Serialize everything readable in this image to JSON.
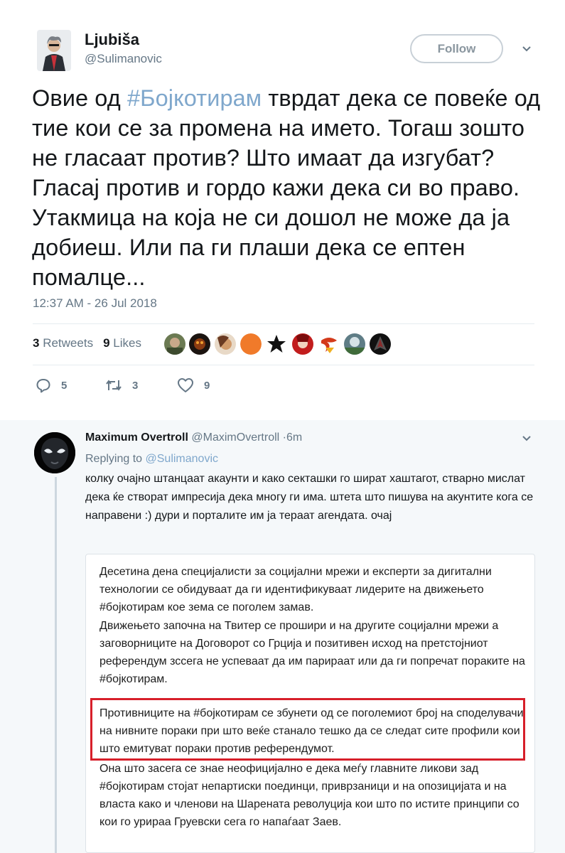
{
  "tweet": {
    "author_name": "Ljubiša",
    "author_handle": "@Sulimanovic",
    "follow_label": "Follow",
    "text_before_hashtag": "Овие од ",
    "hashtag": "#Бојкотирам",
    "text_after_hashtag": " тврдат дека се повеќе од тие кои се за промена на името. Тогаш зошто не гласаат против? Што имаат да изгубат? Гласај против и гордо кажи дека си во право. Утакмица на која не си дошол не може да ја добиеш. Или па ги плаши дека се ептен помалце...",
    "timestamp": "12:37 AM - 26 Jul 2018",
    "retweets_count": "3",
    "retweets_label": "Retweets",
    "likes_count": "9",
    "likes_label": "Likes",
    "actions": {
      "reply_count": "5",
      "retweet_count": "3",
      "like_count": "9"
    }
  },
  "reply": {
    "author_name": "Maximum Overtroll",
    "author_handle": "@MaximOvertroll",
    "time": "·6m",
    "replying_prefix": "Replying to ",
    "replying_mention": "@Sulimanovic",
    "text": "колку очајно штанцаат акаунти и како секташки го шират хаштагот, стварно мислат дека ќе створат импресија дека многу ги има. штета што пишува на акунтите кога се направени :) дури и порталите им ја тераат агендата. очај",
    "card": {
      "paragraph_1": "Десетина дена специјалисти за социјални мрежи и експерти за дигитални технологии се обидуваат да ги идентификуваат лидерите на движењето #бојкотирам кое зема се поголем замав.",
      "paragraph_2": "Движењето започна на Твитер се прошири и на другите социјални мрежи а заговорниците на Договорот со Грција и позитивен исход на претстојниот референдум зссега не успеваат да им парираат или да ги попречат пораките на #бојкотирам.",
      "paragraph_3": "Противниците на #бојкотирам се збунети од се поголемиот број на споделувачи на нивните пораки при што веќе станало тешко да се следат сите профили кои што емитуват пораки против референдумот.",
      "paragraph_4": "Она што засега се знае неофицијално е дека меѓу главните ликови зад #бојкотирам стојат непартиски поединци, приврзаници и на опозицијата и на власта како и членови на Шарената револуција кои што по истите принципи со кои го урираа Груевски сега го напаѓаат Заев."
    }
  },
  "colors": {
    "link": "#7fa7cc",
    "highlight_border": "#d71f2a",
    "secondary_text": "#657786"
  }
}
